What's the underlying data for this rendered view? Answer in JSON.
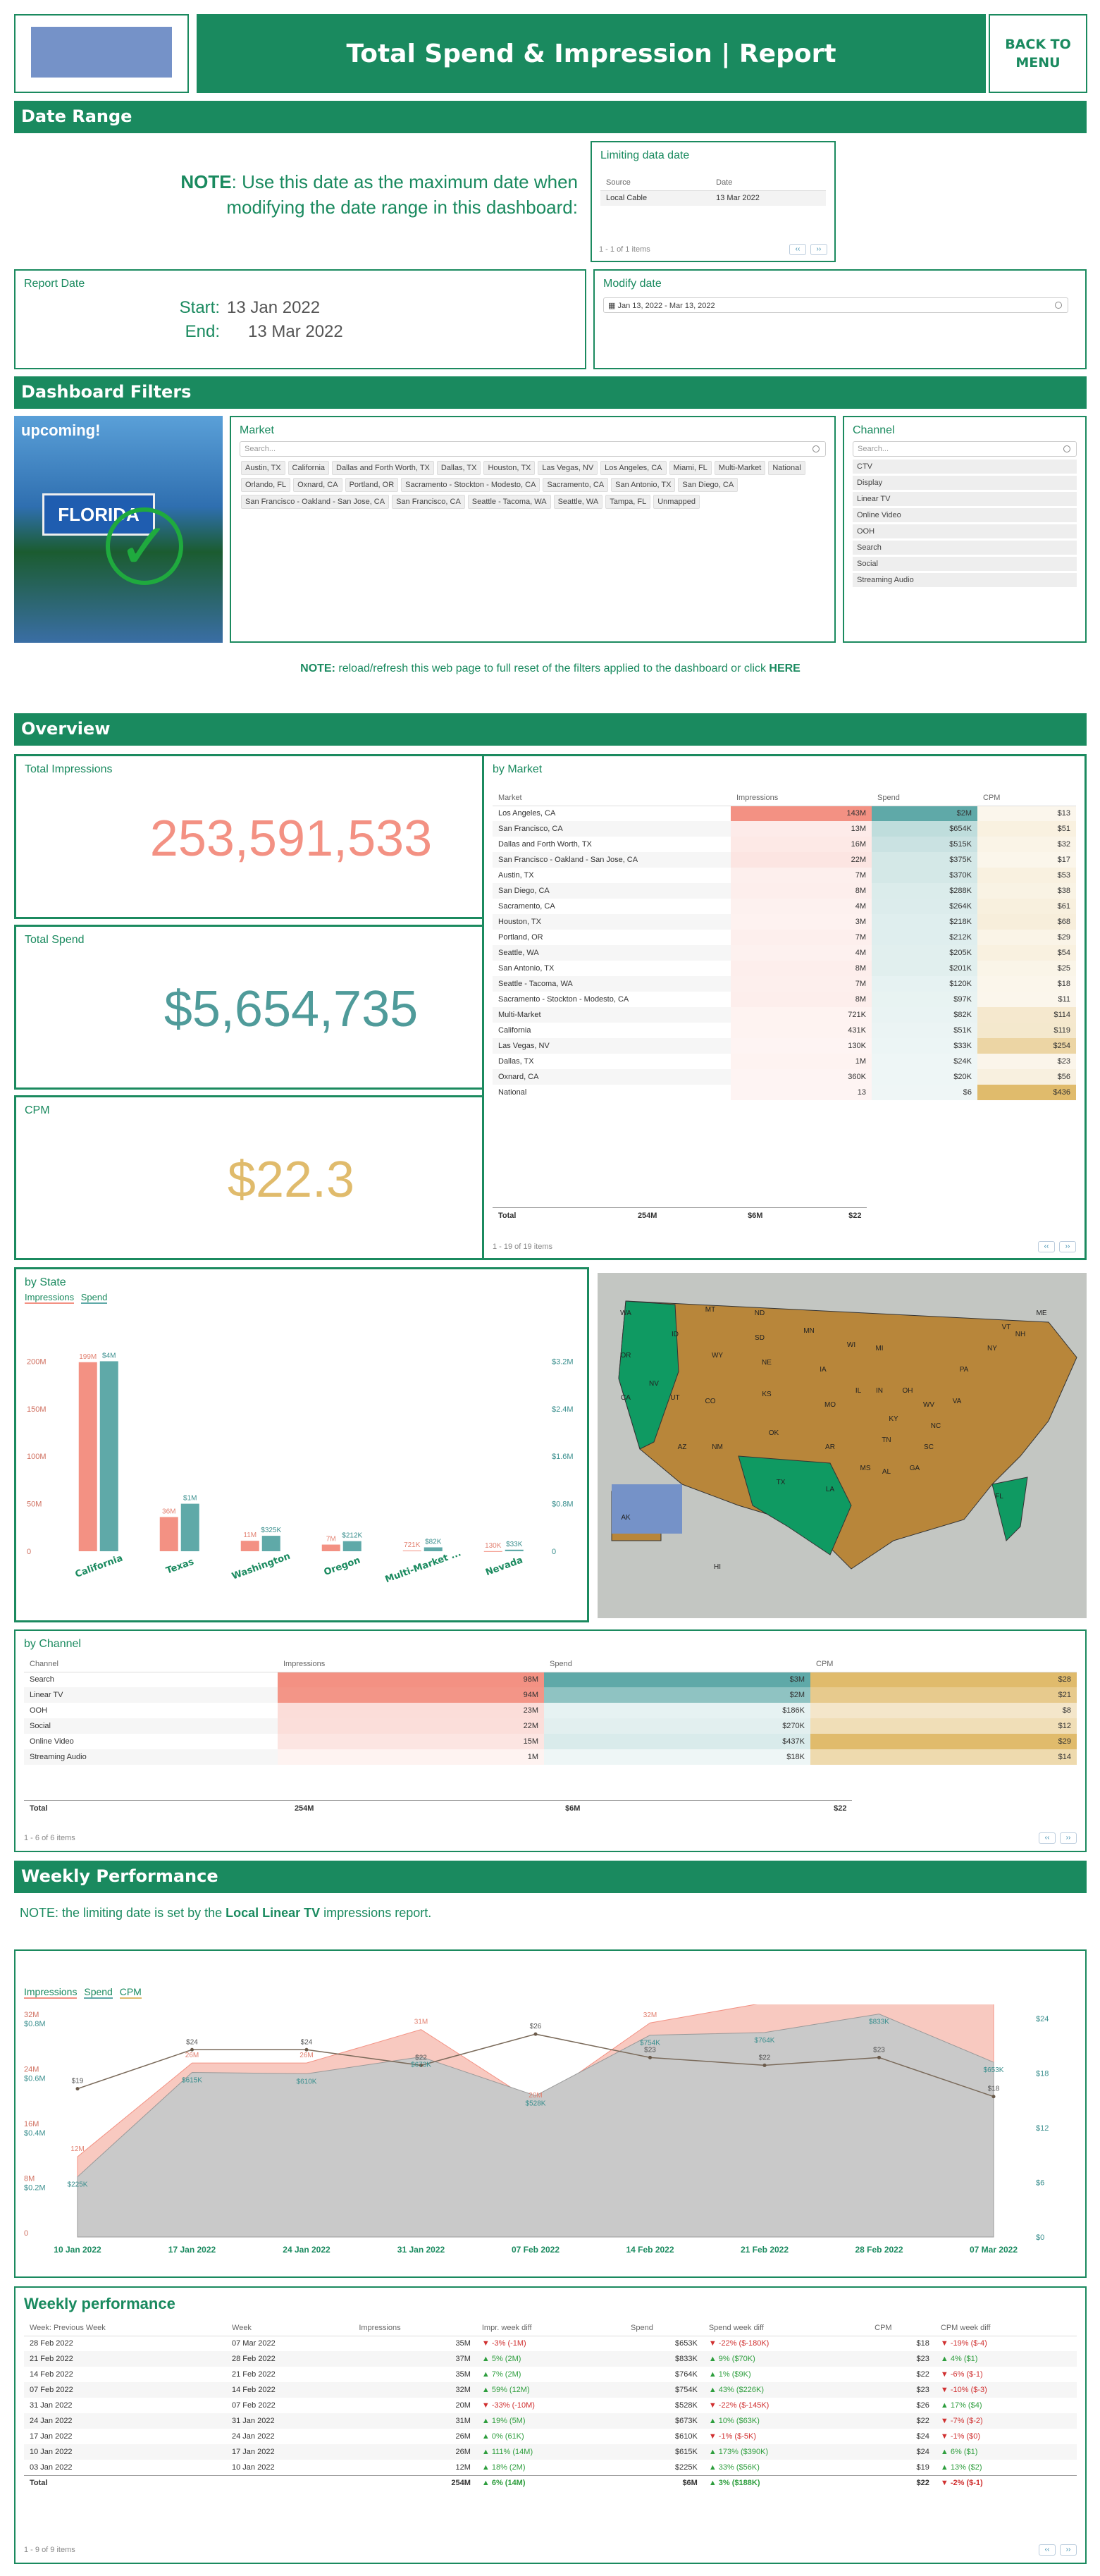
{
  "header": {
    "title": "Total Spend & Impression | Report",
    "back_label": "BACK TO MENU",
    "logo_label": "logo"
  },
  "date_range": {
    "band": "Date Range",
    "note_bold": "NOTE",
    "note_text": ": Use this date as the maximum date when modifying the date range in this dashboard:",
    "limit_title": "Limiting data date",
    "limit_cols": [
      "Source",
      "Date"
    ],
    "limit_row": [
      "Local Cable",
      "13 Mar 2022"
    ],
    "limit_pager": "1 - 1 of 1 items",
    "report_title": "Report Date",
    "start_label": "Start:",
    "start_value": "13 Jan 2022",
    "end_label": "End:",
    "end_value": "13 Mar 2022",
    "modify_title": "Modify date",
    "modify_value": "Jan 13, 2022 - Mar 13, 2022"
  },
  "filters": {
    "band": "Dashboard Filters",
    "upcoming": "upcoming!",
    "market_title": "Market",
    "search_placeholder": "Search...",
    "markets": [
      "Austin, TX",
      "California",
      "Dallas and Forth Worth, TX",
      "Dallas, TX",
      "Houston, TX",
      "Las Vegas, NV",
      "Los Angeles, CA",
      "Miami, FL",
      "Multi-Market",
      "National",
      "Orlando, FL",
      "Oxnard, CA",
      "Portland, OR",
      "Sacramento - Stockton - Modesto, CA",
      "Sacramento, CA",
      "San Antonio, TX",
      "San Diego, CA",
      "San Francisco - Oakland - San Jose, CA",
      "San Francisco, CA",
      "Seattle - Tacoma, WA",
      "Seattle, WA",
      "Tampa, FL",
      "Unmapped"
    ],
    "channel_title": "Channel",
    "channels": [
      "CTV",
      "Display",
      "Linear TV",
      "Online Video",
      "OOH",
      "Search",
      "Social",
      "Streaming Audio"
    ],
    "reset_note_bold": "NOTE:",
    "reset_note_text": " reload/refresh this web page to full reset of the filters applied to the dashboard or click ",
    "reset_link": "HERE"
  },
  "overview": {
    "band": "Overview",
    "total_impressions_title": "Total Impressions",
    "total_impressions": "253,591,533",
    "total_spend_title": "Total Spend",
    "total_spend": "$5,654,735",
    "cpm_title": "CPM",
    "cpm": "$22.3",
    "market_title": "by Market",
    "market_cols": [
      "Market",
      "Impressions",
      "Spend",
      "CPM"
    ],
    "market_rows": [
      [
        "Los Angeles, CA",
        "143M",
        "$2M",
        "$13"
      ],
      [
        "San Francisco, CA",
        "13M",
        "$654K",
        "$51"
      ],
      [
        "Dallas and Forth Worth, TX",
        "16M",
        "$515K",
        "$32"
      ],
      [
        "San Francisco - Oakland - San Jose, CA",
        "22M",
        "$375K",
        "$17"
      ],
      [
        "Austin, TX",
        "7M",
        "$370K",
        "$53"
      ],
      [
        "San Diego, CA",
        "8M",
        "$288K",
        "$38"
      ],
      [
        "Sacramento, CA",
        "4M",
        "$264K",
        "$61"
      ],
      [
        "Houston, TX",
        "3M",
        "$218K",
        "$68"
      ],
      [
        "Portland, OR",
        "7M",
        "$212K",
        "$29"
      ],
      [
        "Seattle, WA",
        "4M",
        "$205K",
        "$54"
      ],
      [
        "San Antonio, TX",
        "8M",
        "$201K",
        "$25"
      ],
      [
        "Seattle - Tacoma, WA",
        "7M",
        "$120K",
        "$18"
      ],
      [
        "Sacramento - Stockton - Modesto, CA",
        "8M",
        "$97K",
        "$11"
      ],
      [
        "Multi-Market",
        "721K",
        "$82K",
        "$114"
      ],
      [
        "California",
        "431K",
        "$51K",
        "$119"
      ],
      [
        "Las Vegas, NV",
        "130K",
        "$33K",
        "$254"
      ],
      [
        "Dallas, TX",
        "1M",
        "$24K",
        "$23"
      ],
      [
        "Oxnard, CA",
        "360K",
        "$20K",
        "$56"
      ],
      [
        "National",
        "13",
        "$6",
        "$436"
      ]
    ],
    "market_impr_frac": [
      1,
      0.09,
      0.11,
      0.15,
      0.05,
      0.06,
      0.03,
      0.02,
      0.05,
      0.03,
      0.06,
      0.05,
      0.06,
      0.01,
      0.01,
      0,
      0.01,
      0,
      0
    ],
    "market_spend_frac": [
      1,
      0.33,
      0.26,
      0.19,
      0.19,
      0.14,
      0.13,
      0.11,
      0.11,
      0.1,
      0.1,
      0.06,
      0.05,
      0.04,
      0.03,
      0.02,
      0.01,
      0.01,
      0
    ],
    "market_cpm_frac": [
      0.03,
      0.12,
      0.07,
      0.04,
      0.12,
      0.09,
      0.14,
      0.16,
      0.07,
      0.12,
      0.06,
      0.04,
      0.03,
      0.26,
      0.27,
      0.58,
      0.05,
      0.13,
      1
    ],
    "market_total": [
      "Total",
      "254M",
      "$6M",
      "$22"
    ],
    "market_pager": "1 - 19 of 19 items"
  },
  "state": {
    "title": "by State",
    "legend": [
      "Impressions",
      "Spend"
    ],
    "chart_data": {
      "type": "bar",
      "categories": [
        "California",
        "Texas",
        "Washington",
        "Oregon",
        "Multi-Market ...",
        "Nevada"
      ],
      "series": [
        {
          "name": "Impressions",
          "values": [
            199000000,
            36000000,
            11000000,
            7000000,
            721000,
            130000
          ],
          "labels": [
            "199M",
            "36M",
            "11M",
            "7M",
            "721K",
            "130K"
          ]
        },
        {
          "name": "Spend",
          "values": [
            4000000,
            1000000,
            325000,
            212000,
            82000,
            33000
          ],
          "labels": [
            "$4M",
            "$1M",
            "$325K",
            "$212K",
            "$82K",
            "$33K"
          ]
        }
      ],
      "yticks_left": [
        "0",
        "50M",
        "100M",
        "150M",
        "200M"
      ],
      "yticks_right": [
        "0",
        "$0.8M",
        "$1.6M",
        "$2.4M",
        "$3.2M"
      ],
      "ylim_left": [
        0,
        230000000
      ],
      "ylim_right": [
        0,
        4600000
      ]
    }
  },
  "map": {
    "state_labels": [
      "WA",
      "OR",
      "CA",
      "NV",
      "ID",
      "MT",
      "ND",
      "SD",
      "WY",
      "NE",
      "UT",
      "CO",
      "KS",
      "AZ",
      "NM",
      "OK",
      "TX",
      "MN",
      "IA",
      "MO",
      "AR",
      "LA",
      "WI",
      "IL",
      "MI",
      "IN",
      "OH",
      "KY",
      "TN",
      "MS",
      "AL",
      "GA",
      "FL",
      "SC",
      "NC",
      "VA",
      "WV",
      "PA",
      "NY",
      "VT",
      "NH",
      "ME",
      "AK",
      "HI"
    ]
  },
  "channel": {
    "title": "by Channel",
    "cols": [
      "Channel",
      "Impressions",
      "Spend",
      "CPM"
    ],
    "rows": [
      [
        "Search",
        "98M",
        "$3M",
        "$28"
      ],
      [
        "Linear TV",
        "94M",
        "$2M",
        "$21"
      ],
      [
        "OOH",
        "23M",
        "$186K",
        "$8"
      ],
      [
        "Social",
        "22M",
        "$270K",
        "$12"
      ],
      [
        "Online Video",
        "15M",
        "$437K",
        "$29"
      ],
      [
        "Streaming Audio",
        "1M",
        "$18K",
        "$14"
      ]
    ],
    "impr_frac": [
      1,
      0.96,
      0.23,
      0.22,
      0.15,
      0.01
    ],
    "spend_frac": [
      1,
      0.67,
      0.06,
      0.09,
      0.15,
      0.01
    ],
    "cpm_frac": [
      1,
      0.75,
      0.29,
      0.43,
      1,
      0.5
    ],
    "total": [
      "Total",
      "254M",
      "$6M",
      "$22"
    ],
    "pager": "1 - 6 of 6 items"
  },
  "weekly": {
    "band": "Weekly Performance",
    "note_pre": "NOTE: the limiting date is set by the ",
    "note_bold": "Local Linear TV",
    "note_post": " impressions report.",
    "legend": [
      "Impressions",
      "Spend",
      "CPM"
    ],
    "chart_data": {
      "type": "area",
      "x": [
        "10 Jan 2022",
        "17 Jan 2022",
        "24 Jan 2022",
        "31 Jan 2022",
        "07 Feb 2022",
        "14 Feb 2022",
        "21 Feb 2022",
        "28 Feb 2022",
        "07 Mar 2022"
      ],
      "series": [
        {
          "name": "Impressions",
          "values": [
            12,
            26,
            26,
            31,
            20,
            32,
            35,
            37,
            35
          ],
          "labels": [
            "12M",
            "26M",
            "26M",
            "31M",
            "20M",
            "32M",
            "35M",
            "37M",
            "35M"
          ]
        },
        {
          "name": "Spend",
          "values": [
            225,
            615,
            610,
            673,
            528,
            754,
            764,
            833,
            653
          ],
          "labels": [
            "$225K",
            "$615K",
            "$610K",
            "$673K",
            "$528K",
            "$754K",
            "$764K",
            "$833K",
            "$653K"
          ]
        },
        {
          "name": "CPM",
          "values": [
            19,
            24,
            24,
            22,
            26,
            23,
            22,
            23,
            18
          ],
          "labels": [
            "$19",
            "$24",
            "$24",
            "$22",
            "$26",
            "$23",
            "$22",
            "$23",
            "$18"
          ]
        }
      ],
      "yticks_left": [
        "0",
        "8M",
        "16M",
        "24M",
        "32M"
      ],
      "yticks_left2": [
        "",
        "$0.2M",
        "$0.4M",
        "$0.6M",
        "$0.8M"
      ],
      "yticks_right": [
        "$0",
        "$6",
        "$12",
        "$18",
        "$24"
      ]
    }
  },
  "weekly_table": {
    "title": "Weekly performance",
    "cols": [
      "Week: Previous Week",
      "Week",
      "Impressions",
      "Impr. week diff",
      "Spend",
      "Spend week diff",
      "CPM",
      "CPM week diff"
    ],
    "rows": [
      [
        "28 Feb 2022",
        "07 Mar 2022",
        "35M",
        "-3% (-1M)",
        "$653K",
        "-22% ($-180K)",
        "$18",
        "-19% ($-4)"
      ],
      [
        "21 Feb 2022",
        "28 Feb 2022",
        "37M",
        "5% (2M)",
        "$833K",
        "9% ($70K)",
        "$23",
        "4% ($1)"
      ],
      [
        "14 Feb 2022",
        "21 Feb 2022",
        "35M",
        "7% (2M)",
        "$764K",
        "1% ($9K)",
        "$22",
        "-6% ($-1)"
      ],
      [
        "07 Feb 2022",
        "14 Feb 2022",
        "32M",
        "59% (12M)",
        "$754K",
        "43% ($226K)",
        "$23",
        "-10% ($-3)"
      ],
      [
        "31 Jan 2022",
        "07 Feb 2022",
        "20M",
        "-33% (-10M)",
        "$528K",
        "-22% ($-145K)",
        "$26",
        "17% ($4)"
      ],
      [
        "24 Jan 2022",
        "31 Jan 2022",
        "31M",
        "19% (5M)",
        "$673K",
        "10% ($63K)",
        "$22",
        "-7% ($-2)"
      ],
      [
        "17 Jan 2022",
        "24 Jan 2022",
        "26M",
        "0% (61K)",
        "$610K",
        "-1% ($-5K)",
        "$24",
        "-1% ($0)"
      ],
      [
        "10 Jan 2022",
        "17 Jan 2022",
        "26M",
        "111% (14M)",
        "$615K",
        "173% ($390K)",
        "$24",
        "6% ($1)"
      ],
      [
        "03 Jan 2022",
        "10 Jan 2022",
        "12M",
        "18% (2M)",
        "$225K",
        "33% ($56K)",
        "$19",
        "13% ($2)"
      ]
    ],
    "total": [
      "Total",
      "",
      "254M",
      "6% (14M)",
      "$6M",
      "3% ($188K)",
      "$22",
      "-2% ($-1)"
    ],
    "pager": "1 - 9 of 9 items"
  },
  "colors": {
    "green": "#1a8a5f",
    "salmon": "#f39183",
    "teal": "#5fa9a8",
    "gold": "#e0bb6c"
  }
}
